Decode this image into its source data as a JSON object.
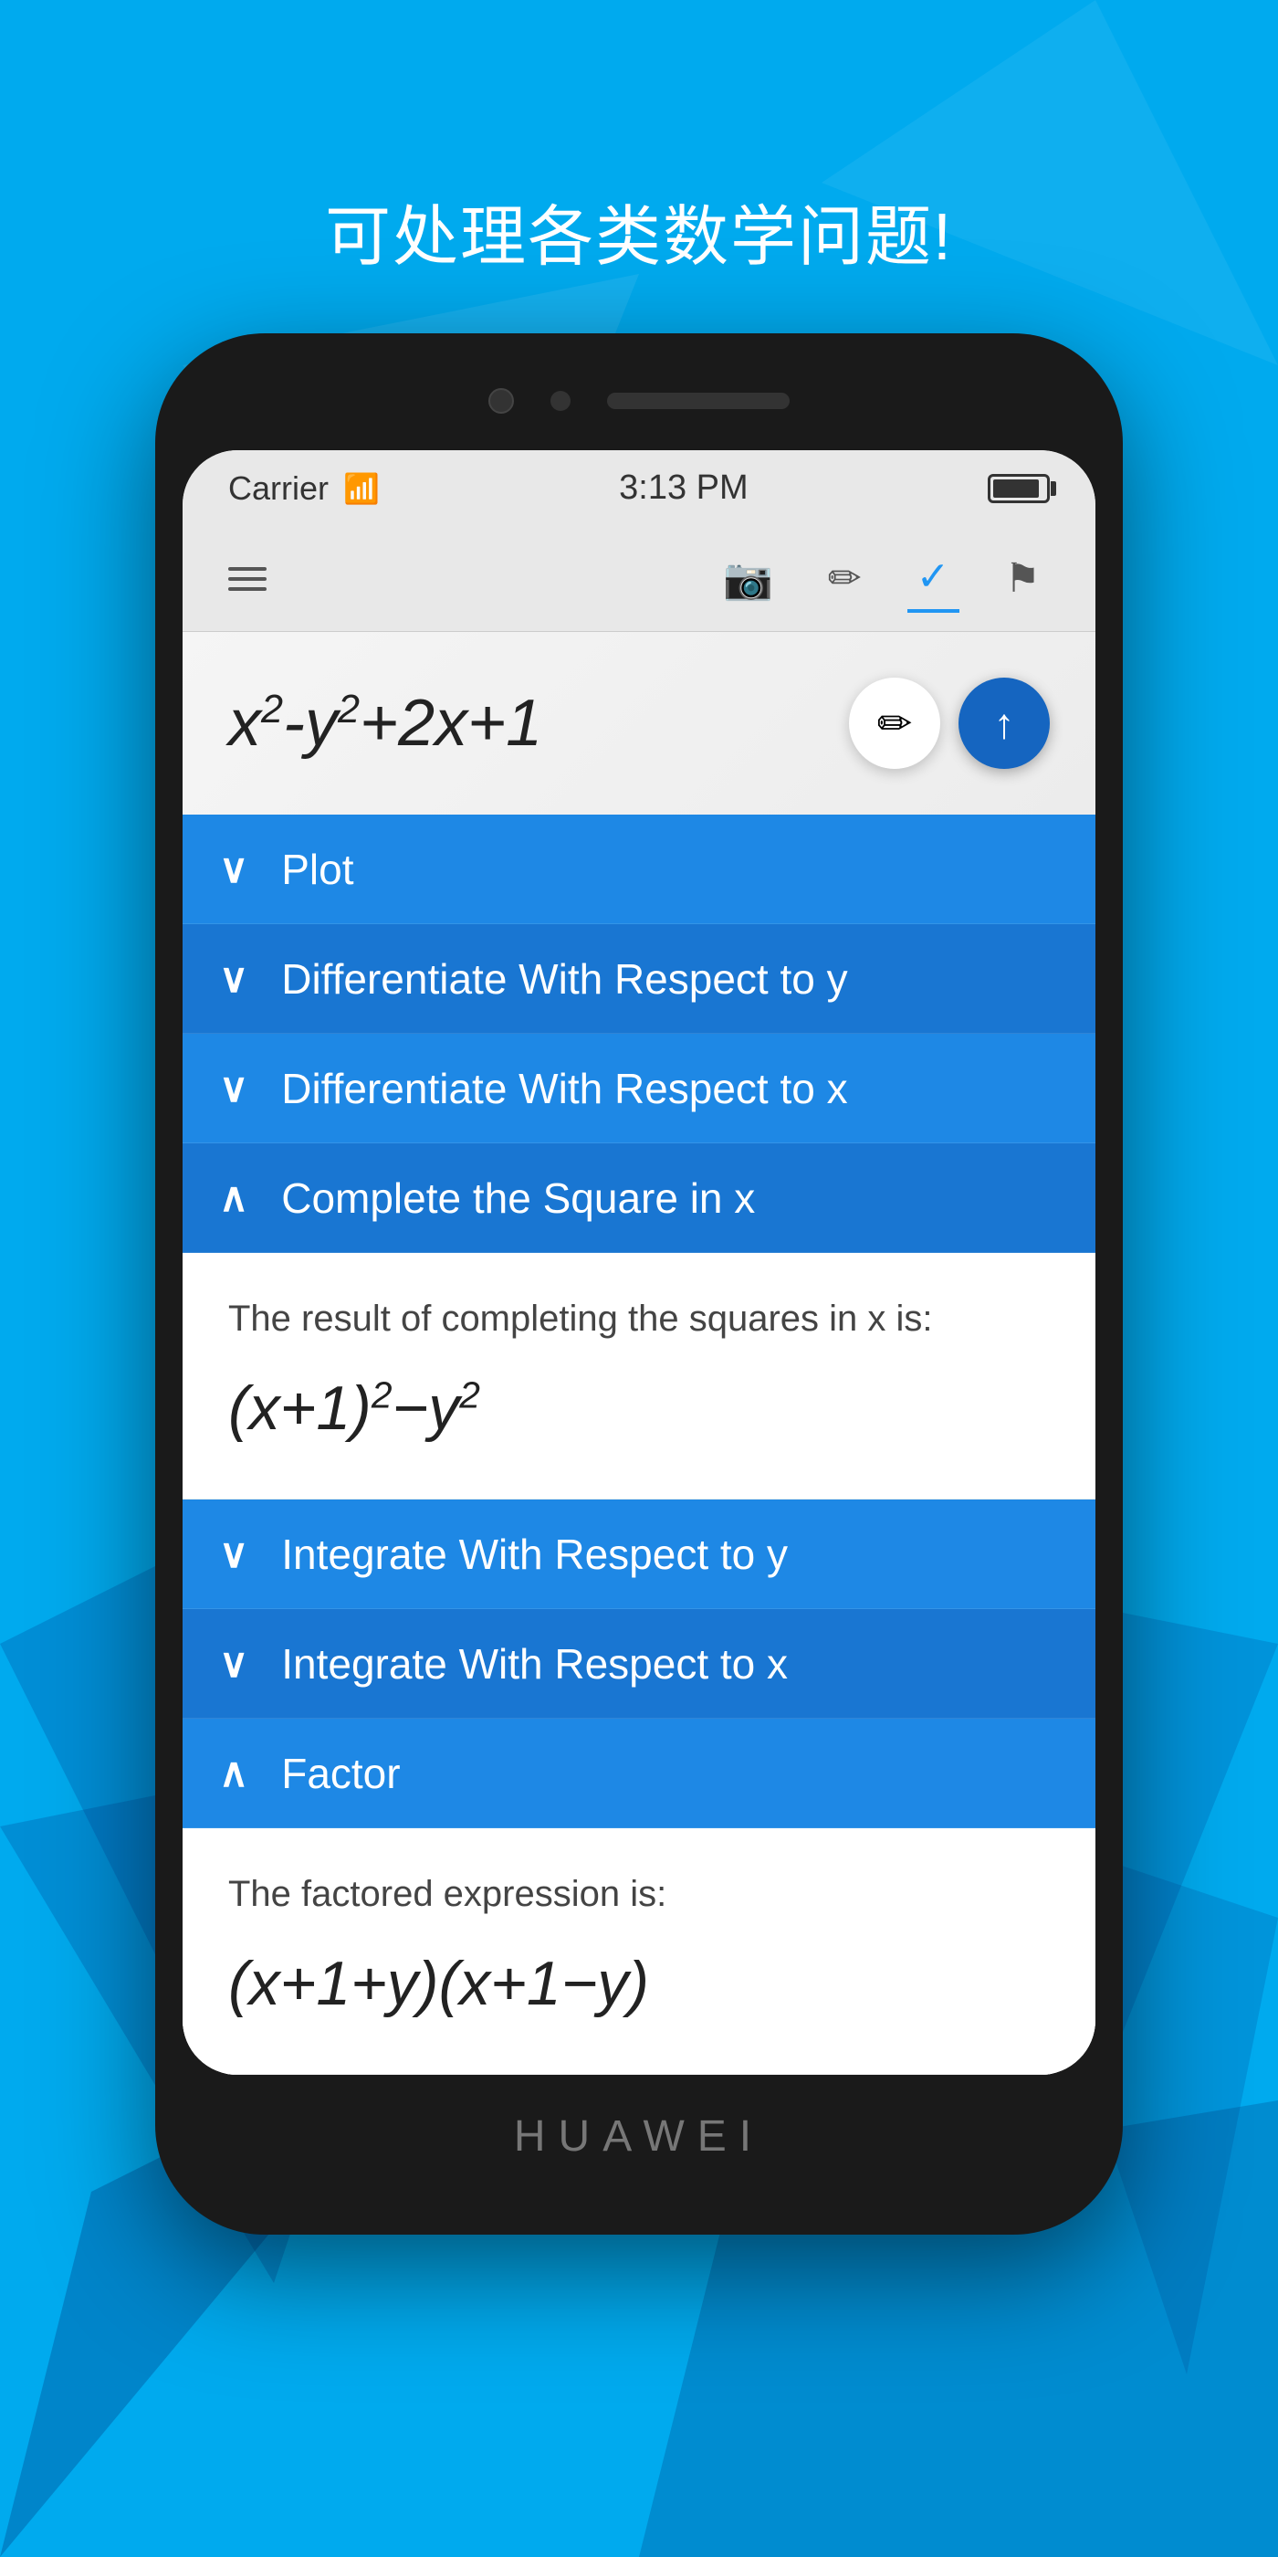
{
  "page": {
    "title": "可处理各类数学问题!",
    "background_color": "#00aaee"
  },
  "status_bar": {
    "carrier": "Carrier",
    "time": "3:13 PM"
  },
  "expression": {
    "text": "x²-y²+2x+1",
    "text_html": "x<sup>2</sup>-y<sup>2</sup>+2x+1"
  },
  "toolbar": {
    "edit_label": "✏",
    "upload_label": "↑"
  },
  "menu_items": [
    {
      "id": "plot",
      "label": "Plot",
      "expanded": false,
      "chevron": "chevron-down"
    },
    {
      "id": "diff-y",
      "label": "Differentiate With Respect to y",
      "expanded": false,
      "chevron": "chevron-down"
    },
    {
      "id": "diff-x",
      "label": "Differentiate With Respect to x",
      "expanded": false,
      "chevron": "chevron-down"
    },
    {
      "id": "complete-square",
      "label": "Complete the Square in x",
      "expanded": true,
      "chevron": "chevron-up"
    },
    {
      "id": "integrate-y",
      "label": "Integrate With Respect to y",
      "expanded": false,
      "chevron": "chevron-down"
    },
    {
      "id": "integrate-x",
      "label": "Integrate With Respect to x",
      "expanded": false,
      "chevron": "chevron-down"
    },
    {
      "id": "factor",
      "label": "Factor",
      "expanded": true,
      "chevron": "chevron-up"
    }
  ],
  "expanded_results": {
    "complete_square": {
      "description": "The result of completing the squares in x is:",
      "formula_html": "(x+1)<sup>2</sup>−y<sup>2</sup>"
    },
    "factor": {
      "description": "The factored expression is:",
      "formula_html": "(x+1+y)(x+1−y)"
    }
  },
  "phone": {
    "brand": "HUAWEI"
  }
}
